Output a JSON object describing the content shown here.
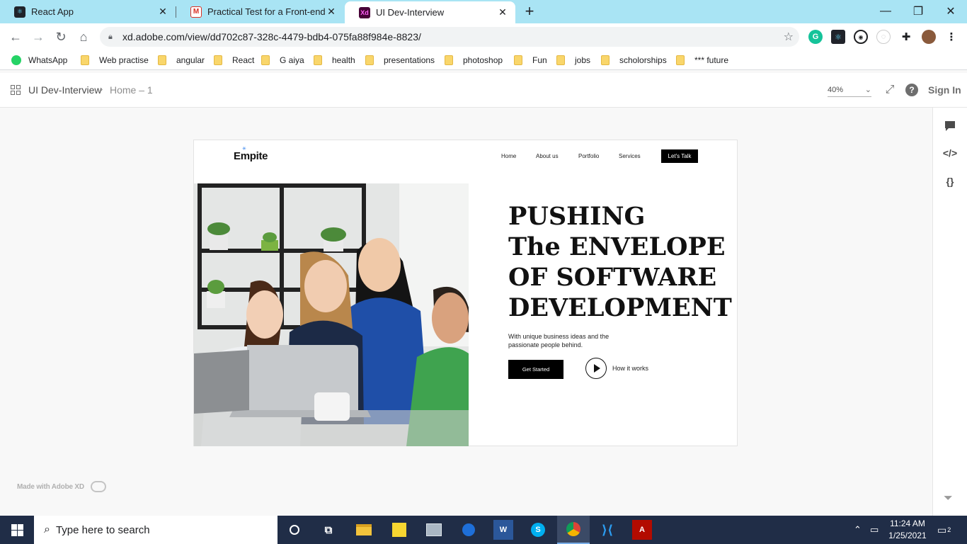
{
  "browser": {
    "tabs": [
      {
        "title": "React App",
        "favicon": "react-icon",
        "active": false
      },
      {
        "title": "Practical Test for a Front-end Dev",
        "favicon": "gmail-icon",
        "active": false
      },
      {
        "title": "UI Dev-Interview",
        "favicon": "xd-icon",
        "active": true
      }
    ],
    "new_tab": "+",
    "url": "xd.adobe.com/view/dd702c87-328c-4479-bdb4-075fa88f984e-8823/",
    "bookmarks": [
      "WhatsApp",
      "Web practise",
      "angular",
      "React",
      "G aiya",
      "health",
      "presentations",
      "photoshop",
      "Fun",
      "jobs",
      "scholorships",
      "*** future"
    ]
  },
  "xd": {
    "project": "UI Dev-Interview",
    "page": "Home – 1",
    "zoom": "40%",
    "sign_in": "Sign In",
    "made_with": "Made with Adobe XD"
  },
  "artboard": {
    "logo": "Empite",
    "nav": [
      "Home",
      "About us",
      "Portfolio",
      "Services"
    ],
    "cta": "Let's Talk",
    "headline": [
      "PUSHING",
      "The ENVELOPE",
      "OF SOFTWARE",
      "DEVELOPMENT"
    ],
    "subtitle": "With unique business ideas and the passionate people behind.",
    "primary_button": "Get Started",
    "secondary_link": "How it works"
  },
  "taskbar": {
    "search_placeholder": "Type here to search",
    "time": "11:24 AM",
    "date": "1/25/2021",
    "notifications": "2"
  },
  "colors": {
    "tabstrip": "#a9e4f4",
    "taskbar": "#202d47",
    "cta": "#000000",
    "xd_brand": "#470137"
  }
}
